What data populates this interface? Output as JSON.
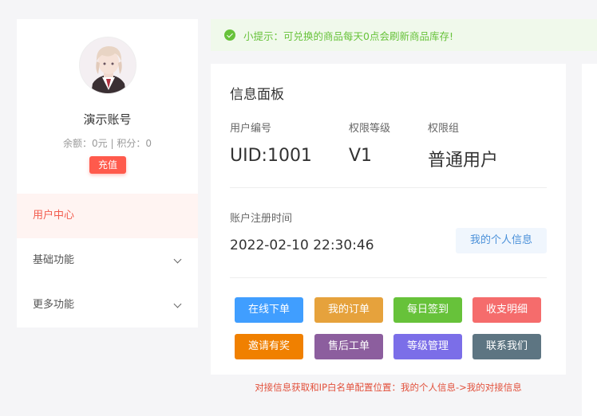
{
  "tip": {
    "text": "小提示：可兑换的商品每天0点会刷新商品库存!"
  },
  "user": {
    "name": "演示账号",
    "balance_line": "余额：0元 | 积分：0",
    "recharge_label": "充值"
  },
  "nav": {
    "items": [
      {
        "label": "用户中心",
        "active": true
      },
      {
        "label": "基础功能",
        "expandable": true
      },
      {
        "label": "更多功能",
        "expandable": true
      }
    ]
  },
  "panel": {
    "title": "信息面板",
    "fields": [
      {
        "label": "用户编号",
        "value": "UID:1001"
      },
      {
        "label": "权限等级",
        "value": "V1"
      },
      {
        "label": "权限组",
        "value": "普通用户"
      }
    ],
    "reg_label": "账户注册时间",
    "reg_value": "2022-02-10 22:30:46",
    "myinfo_label": "我的个人信息"
  },
  "actions": [
    {
      "label": "在线下单",
      "color": "#409eff"
    },
    {
      "label": "我的订单",
      "color": "#e6a23c"
    },
    {
      "label": "每日签到",
      "color": "#67c23a"
    },
    {
      "label": "收支明细",
      "color": "#f56c6c"
    },
    {
      "label": "邀请有奖",
      "color": "#f08000"
    },
    {
      "label": "售后工单",
      "color": "#8c5e9e"
    },
    {
      "label": "等级管理",
      "color": "#7b6ee8"
    },
    {
      "label": "联系我们",
      "color": "#5d7582"
    }
  ],
  "note": {
    "text": "对接信息获取和IP白名单配置位置：我的个人信息->我的对接信息"
  }
}
